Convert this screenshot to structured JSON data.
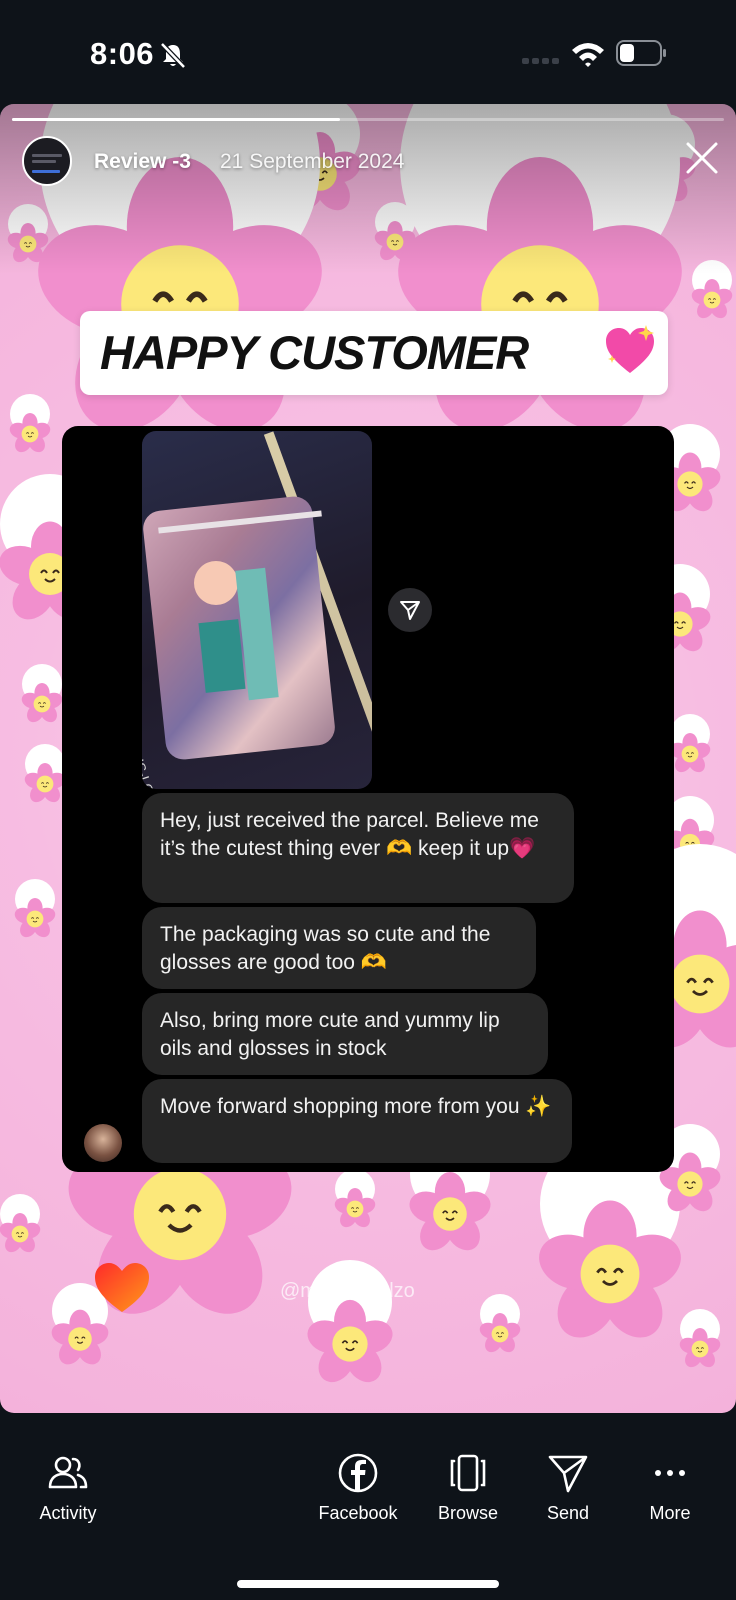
{
  "status_bar": {
    "time": "8:06"
  },
  "story": {
    "progress": 0.46,
    "title": "Review -3",
    "date": "21 September 2024",
    "banner": "HAPPY CUSTOMER",
    "photo_caption": "HS-LC05",
    "messages": [
      "Hey, just received the parcel. Believe me it’s the cutest thing ever 🫶 keep it up💗",
      "The packaging was so cute and the glosses are good too 🫶",
      "Also, bring more cute and yummy lip oils and glosses in stock",
      "Move forward shopping more from you ✨"
    ],
    "watermark": "@mammafulzo"
  },
  "bottom_actions": {
    "activity": "Activity",
    "facebook": "Facebook",
    "browse": "Browse",
    "send": "Send",
    "more": "More"
  },
  "colors": {
    "background": "#0e1319",
    "story_pink": "#f7bde2",
    "flower_pink": "#f18fcd",
    "flower_center": "#fce87a",
    "bubble": "#262626"
  }
}
